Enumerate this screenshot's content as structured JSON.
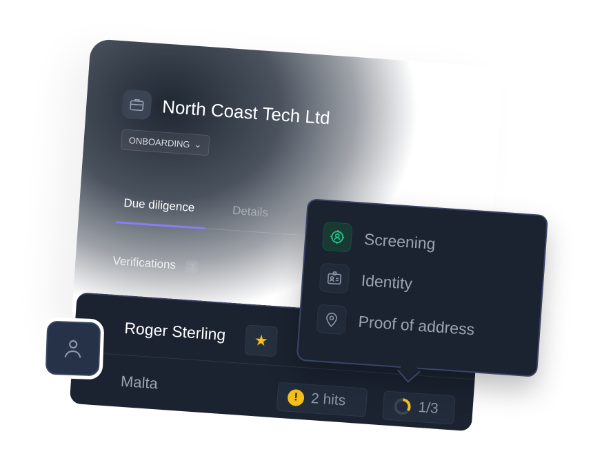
{
  "company": {
    "name": "North Coast Tech Ltd",
    "icon": "briefcase-icon",
    "status": "ONBOARDING"
  },
  "tabs": [
    {
      "label": "Due diligence",
      "active": true
    },
    {
      "label": "Details",
      "active": false
    }
  ],
  "verifications": {
    "label": "Verifications",
    "count": "3"
  },
  "person": {
    "name": "Roger Sterling",
    "starred": true,
    "country": "Malta",
    "hits": "2 hits",
    "progress": "1/3",
    "progress_fraction": 0.333
  },
  "menu": {
    "items": [
      {
        "label": "Screening",
        "icon": "screening-target-icon",
        "active": true
      },
      {
        "label": "Identity",
        "icon": "id-card-icon",
        "active": false
      },
      {
        "label": "Proof of address",
        "icon": "location-pin-icon",
        "active": false
      }
    ]
  },
  "colors": {
    "accent": "#8b7cf6",
    "warning": "#f5c01a",
    "success": "#22c58b",
    "card": "#1b2331"
  }
}
